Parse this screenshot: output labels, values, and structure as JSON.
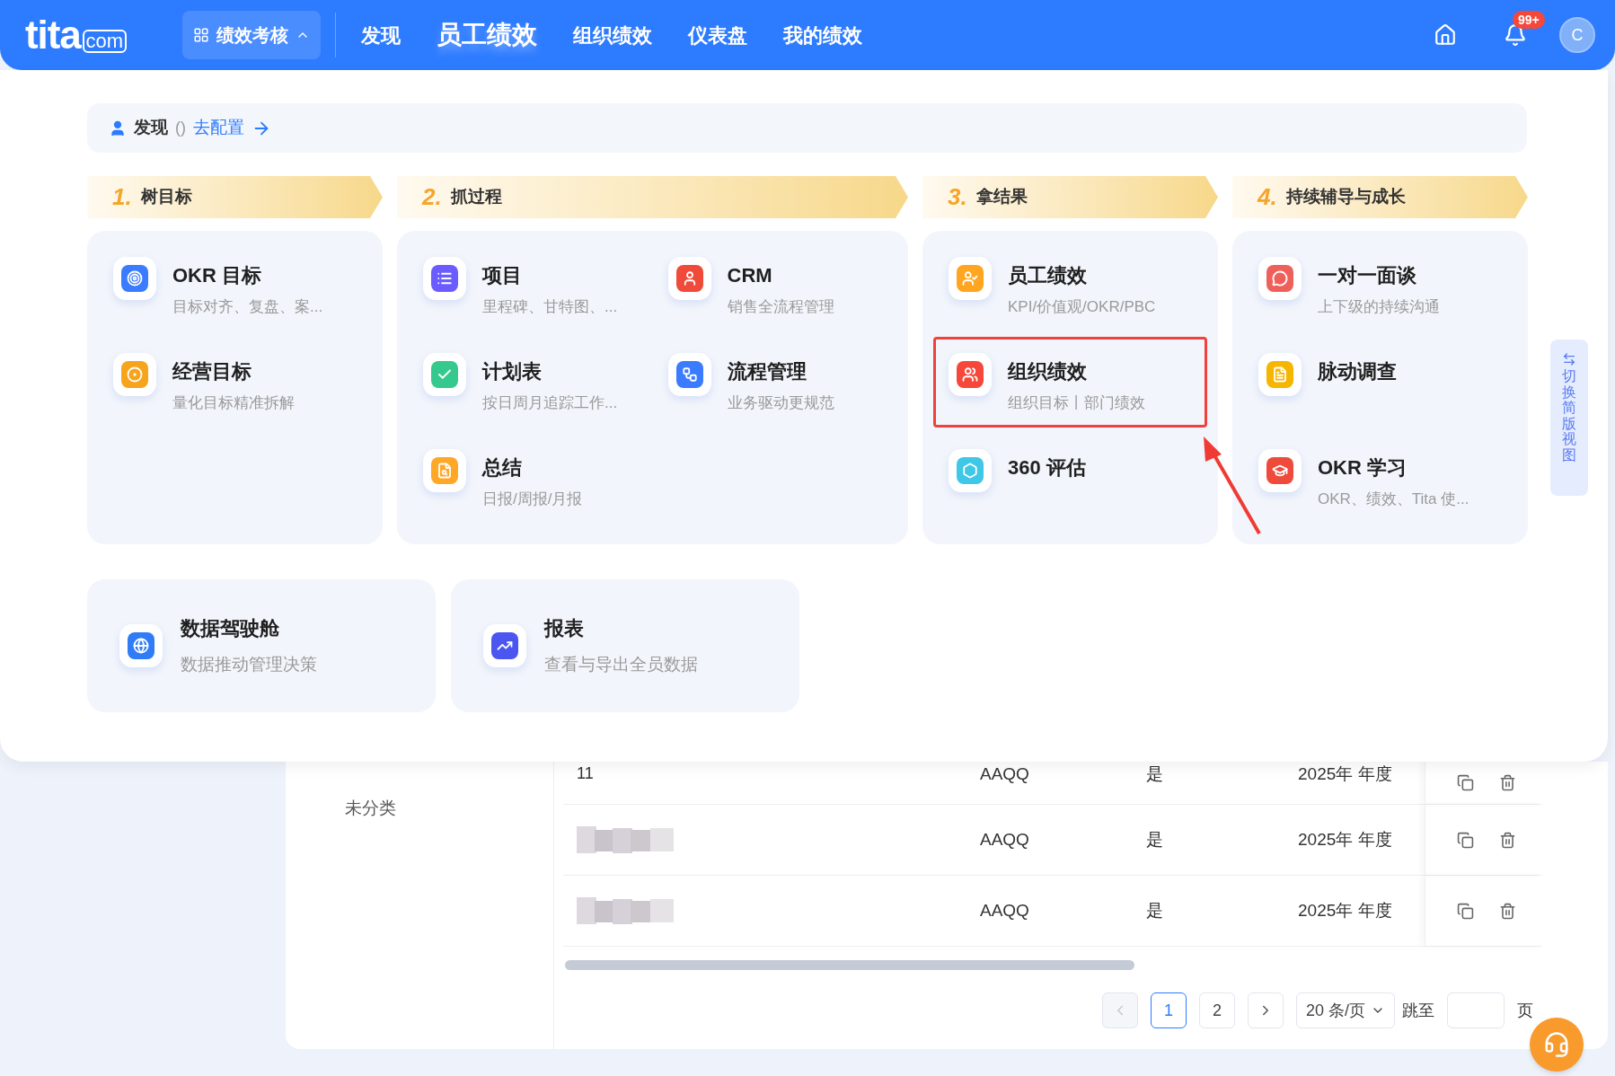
{
  "top_bar": {
    "logo": {
      "main": "tita",
      "suffix": "com"
    },
    "module_switcher": {
      "label": "绩效考核",
      "expanded": true
    },
    "nav": [
      {
        "label": "发现",
        "selected": false
      },
      {
        "label": "员工绩效",
        "selected": true
      },
      {
        "label": "组织绩效",
        "selected": false
      },
      {
        "label": "仪表盘",
        "selected": false
      },
      {
        "label": "我的绩效",
        "selected": false
      }
    ],
    "notification_badge": "99+",
    "avatar": "C"
  },
  "discover": {
    "breadcrumb": {
      "title": "发现",
      "count": "()",
      "link": "去配置"
    },
    "stages": [
      {
        "number": "1.",
        "label": "树目标",
        "columns": [
          [
            {
              "title": "OKR 目标",
              "subtitle": "目标对齐、复盘、案...",
              "highlighted": false
            },
            {
              "title": "经营目标",
              "subtitle": "量化目标精准拆解",
              "highlighted": false
            }
          ]
        ]
      },
      {
        "number": "2.",
        "label": "抓过程",
        "columns": [
          [
            {
              "title": "项目",
              "subtitle": "里程碑、甘特图、...",
              "highlighted": false
            },
            {
              "title": "计划表",
              "subtitle": "按日周月追踪工作...",
              "highlighted": false
            },
            {
              "title": "总结",
              "subtitle": "日报/周报/月报",
              "highlighted": false
            }
          ],
          [
            {
              "title": "CRM",
              "subtitle": "销售全流程管理",
              "highlighted": false
            },
            {
              "title": "流程管理",
              "subtitle": "业务驱动更规范",
              "highlighted": false
            }
          ]
        ]
      },
      {
        "number": "3.",
        "label": "拿结果",
        "columns": [
          [
            {
              "title": "员工绩效",
              "subtitle": "KPI/价值观/OKR/PBC",
              "highlighted": false
            },
            {
              "title": "组织绩效",
              "subtitle": "组织目标丨部门绩效",
              "highlighted": true
            },
            {
              "title": "360 评估",
              "highlighted": false
            }
          ]
        ]
      },
      {
        "number": "4.",
        "label": "持续辅导与成长",
        "columns": [
          [
            {
              "title": "一对一面谈",
              "subtitle": "上下级的持续沟通",
              "highlighted": false
            },
            {
              "title": "脉动调查",
              "highlighted": false
            },
            {
              "title": "OKR 学习",
              "subtitle": "OKR、绩效、Tita 使...",
              "highlighted": false
            }
          ]
        ]
      }
    ],
    "extras": [
      {
        "title": "数据驾驶舱",
        "subtitle": "数据推动管理决策"
      },
      {
        "title": "报表",
        "subtitle": "查看与导出全员数据"
      }
    ],
    "side_tab": "切换简版视图"
  },
  "table": {
    "category": "未分类",
    "rows": [
      {
        "name": "11",
        "redacted": false,
        "code": "AAQQ",
        "flag": "是",
        "period": "2025年 年度"
      },
      {
        "redacted": true,
        "code": "AAQQ",
        "flag": "是",
        "period": "2025年 年度"
      },
      {
        "redacted": true,
        "code": "AAQQ",
        "flag": "是",
        "period": "2025年 年度"
      }
    ],
    "pagination": {
      "pages": [
        {
          "label": "1",
          "selected": true
        },
        {
          "label": "2",
          "selected": false
        }
      ],
      "prev_disabled": true,
      "page_size": "20 条/页",
      "jump_label": "跳至",
      "page_suffix": "页"
    }
  }
}
